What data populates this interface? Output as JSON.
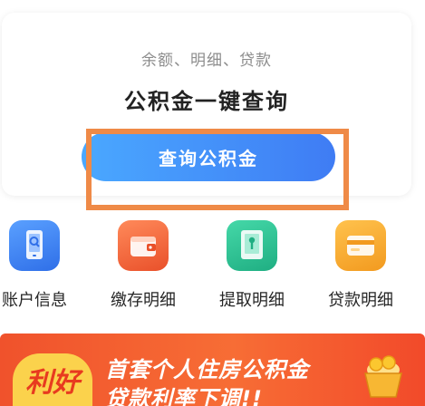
{
  "card": {
    "subtitle": "余额、明细、贷款",
    "title": "公积金一键查询",
    "button_label": "查询公积金"
  },
  "features": [
    {
      "label": "账户信息",
      "icon": "phone-search-icon",
      "color": "#3d84f5"
    },
    {
      "label": "缴存明细",
      "icon": "wallet-icon",
      "color": "#f2683b"
    },
    {
      "label": "提取明细",
      "icon": "document-withdraw-icon",
      "color": "#2bbf93"
    },
    {
      "label": "贷款明细",
      "icon": "card-icon",
      "color": "#f6a531"
    }
  ],
  "banner": {
    "badge_text": "利好",
    "line1": "首套个人住房公积金",
    "line2": "贷款利率下调!!"
  },
  "colors": {
    "button_start": "#4aa8ff",
    "button_end": "#3f7cf4",
    "highlight": "#ef8a47",
    "banner": "#f0522c"
  }
}
